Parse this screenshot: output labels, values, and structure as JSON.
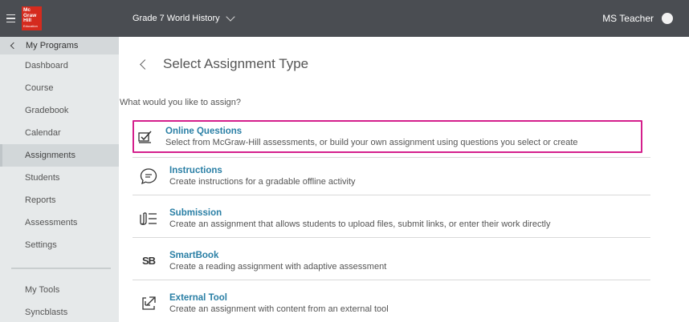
{
  "header": {
    "logo": {
      "line1": "Mc",
      "line2": "Graw",
      "line3": "Hill",
      "line4": "Education"
    },
    "course_title": "Grade 7 World History",
    "user_name": "MS Teacher"
  },
  "sidebar": {
    "section_label": "My Programs",
    "items": [
      {
        "label": "Dashboard"
      },
      {
        "label": "Course"
      },
      {
        "label": "Gradebook"
      },
      {
        "label": "Calendar"
      },
      {
        "label": "Assignments"
      },
      {
        "label": "Students"
      },
      {
        "label": "Reports"
      },
      {
        "label": "Assessments"
      },
      {
        "label": "Settings"
      }
    ],
    "tools": [
      {
        "label": "My Tools"
      },
      {
        "label": "Syncblasts"
      }
    ]
  },
  "main": {
    "title": "Select Assignment Type",
    "prompt": "What would you like to assign?",
    "options": [
      {
        "title": "Online Questions",
        "description": "Select from McGraw-Hill assessments, or build your own assignment using questions you select or create",
        "icon": "edit-checkbox-icon"
      },
      {
        "title": "Instructions",
        "description": "Create instructions for a gradable offline activity",
        "icon": "chat-bubble-icon"
      },
      {
        "title": "Submission",
        "description": "Create an assignment that allows students to upload files, submit links, or enter their work directly",
        "icon": "paperclip-list-icon"
      },
      {
        "title": "SmartBook",
        "description": "Create a reading assignment with adaptive assessment",
        "icon": "smartbook-icon",
        "icon_text": "SB"
      },
      {
        "title": "External Tool",
        "description": "Create an assignment with content from an external tool",
        "icon": "external-link-icon"
      }
    ]
  },
  "colors": {
    "topbar": "#4a4d52",
    "sidebar": "#e6e9ea",
    "link": "#2a7fa5",
    "highlight": "#d41f8c"
  }
}
